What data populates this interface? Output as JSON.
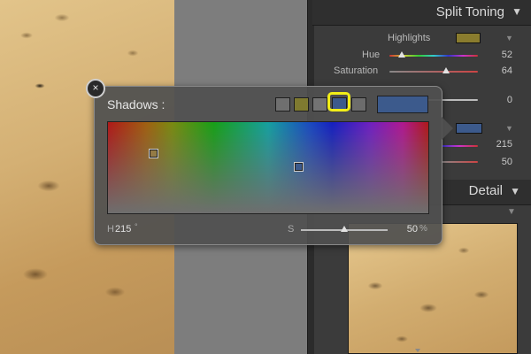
{
  "split_toning": {
    "title": "Split Toning",
    "highlights": {
      "label": "Highlights",
      "color": "#8a7c2e"
    },
    "hue": {
      "label": "Hue",
      "value": "52",
      "fraction": 0.14
    },
    "saturation": {
      "label": "Saturation",
      "value": "64",
      "fraction": 0.64
    },
    "balance": {
      "value": "0",
      "fraction": 0.5
    },
    "shadows": {
      "color": "#3c5a8c",
      "hue_value": "215",
      "saturation_value": "50"
    }
  },
  "detail": {
    "title": "Detail"
  },
  "popup": {
    "title": "Shadows :",
    "close_glyph": "×",
    "presets": [
      {
        "color": "#6f6f6f"
      },
      {
        "color": "#7f7a30"
      },
      {
        "color": "#737373"
      },
      {
        "color": "#3c5a8c",
        "selected": true
      },
      {
        "color": "#6c6c6c"
      }
    ],
    "current_color": "#3c5a8c",
    "h_label": "H",
    "h_value": "215",
    "h_unit": "°",
    "s_label": "S",
    "s_value": "50",
    "s_unit": "%",
    "s_fraction": 0.5
  }
}
